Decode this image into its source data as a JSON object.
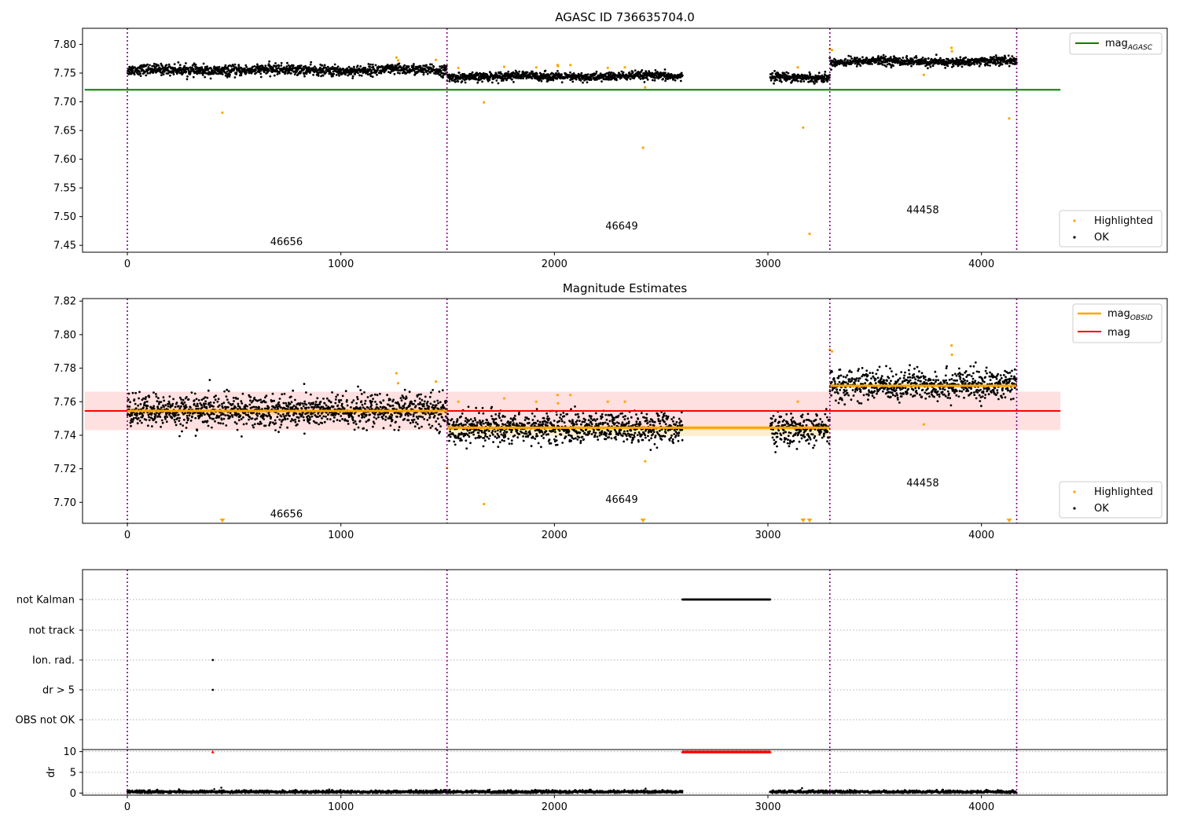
{
  "chart_data": [
    {
      "type": "scatter",
      "title": "AGASC ID 736635704.0",
      "xlabel": "",
      "ylabel": "",
      "xlim": [
        -210,
        4870
      ],
      "ylim": [
        7.438,
        7.828
      ],
      "x_ticks": [
        0,
        1000,
        2000,
        3000,
        4000
      ],
      "y_ticks": [
        7.45,
        7.5,
        7.55,
        7.6,
        7.65,
        7.7,
        7.75,
        7.8
      ],
      "y_tick_labels": [
        "7.45",
        "7.50",
        "7.55",
        "7.60",
        "7.65",
        "7.70",
        "7.75",
        "7.80"
      ],
      "obsid_boundaries": [
        0,
        1497,
        3290,
        4165
      ],
      "obsid_labels": [
        {
          "text": "46656",
          "x": 745,
          "y": 7.456
        },
        {
          "text": "46649",
          "x": 2315,
          "y": 7.483
        },
        {
          "text": "44458",
          "x": 3725,
          "y": 7.511
        }
      ],
      "segments": [
        {
          "x": [
            0,
            1497
          ],
          "y": 7.755,
          "spread": 0.006
        },
        {
          "x": [
            1497,
            2600
          ],
          "y": 7.744,
          "spread": 0.005
        },
        {
          "x": [
            3010,
            3290
          ],
          "y": 7.743,
          "spread": 0.005
        },
        {
          "x": [
            3290,
            4165
          ],
          "y": 7.77,
          "spread": 0.005
        }
      ],
      "series": [
        {
          "name": "mag$_{AGASC}$",
          "kind": "hline",
          "value": 7.721,
          "x": [
            -200,
            4370
          ],
          "color": "#008000"
        },
        {
          "name": "Highlighted",
          "kind": "scatter",
          "color": "#ffa500",
          "points": [
            [
              445,
              7.681
            ],
            [
              1260,
              7.777
            ],
            [
              1268,
              7.772
            ],
            [
              1445,
              7.773
            ],
            [
              1550,
              7.759
            ],
            [
              1670,
              7.699
            ],
            [
              1765,
              7.761
            ],
            [
              1915,
              7.76
            ],
            [
              2015,
              7.764
            ],
            [
              2017,
              7.762
            ],
            [
              2075,
              7.764
            ],
            [
              2250,
              7.759
            ],
            [
              2330,
              7.76
            ],
            [
              2415,
              7.62
            ],
            [
              2425,
              7.725
            ],
            [
              3140,
              7.76
            ],
            [
              3165,
              7.655
            ],
            [
              3195,
              7.47
            ],
            [
              3290,
              7.792
            ],
            [
              3300,
              7.79
            ],
            [
              3730,
              7.747
            ],
            [
              3860,
              7.794
            ],
            [
              3862,
              7.788
            ],
            [
              4130,
              7.671
            ]
          ]
        },
        {
          "name": "OK",
          "kind": "scatter",
          "color": "#000000",
          "points": "dense cloud following segments"
        }
      ],
      "legend": [
        {
          "label": "mag",
          "sub": "AGASC",
          "marker": "line",
          "color": "#008000",
          "position": "upper-right"
        },
        {
          "label": "Highlighted",
          "marker": "dot",
          "color": "#ffa500",
          "position": "lower-right"
        },
        {
          "label": "OK",
          "marker": "dot",
          "color": "#000000",
          "position": "lower-right"
        }
      ]
    },
    {
      "type": "scatter",
      "title": "Magnitude Estimates",
      "xlabel": "",
      "ylabel": "",
      "xlim": [
        -210,
        4870
      ],
      "ylim": [
        7.6875,
        7.8215
      ],
      "x_ticks": [
        0,
        1000,
        2000,
        3000,
        4000
      ],
      "y_ticks": [
        7.7,
        7.72,
        7.74,
        7.76,
        7.78,
        7.8,
        7.82
      ],
      "y_tick_labels": [
        "7.70",
        "7.72",
        "7.74",
        "7.76",
        "7.78",
        "7.80",
        "7.82"
      ],
      "obsid_boundaries": [
        0,
        1497,
        3290,
        4165
      ],
      "obsid_labels": [
        {
          "text": "46656",
          "x": 745,
          "y": 7.693
        },
        {
          "text": "46649",
          "x": 2315,
          "y": 7.7015
        },
        {
          "text": "44458",
          "x": 3725,
          "y": 7.7115
        }
      ],
      "mag_band": {
        "center": 7.7545,
        "low": 7.743,
        "high": 7.766,
        "x": [
          -200,
          4370
        ],
        "color": "#ff0000"
      },
      "obsid_mag": [
        {
          "x": [
            0,
            1497
          ],
          "value": 7.7545,
          "low": 7.752,
          "high": 7.757
        },
        {
          "x": [
            1497,
            3290
          ],
          "value": 7.7445,
          "low": 7.7395,
          "high": 7.7455
        },
        {
          "x": [
            3290,
            4165
          ],
          "value": 7.7695,
          "low": 7.768,
          "high": 7.771
        }
      ],
      "segments": [
        {
          "x": [
            0,
            1497
          ],
          "y": 7.7545,
          "spread": 0.0065
        },
        {
          "x": [
            1497,
            2600
          ],
          "y": 7.7445,
          "spread": 0.006
        },
        {
          "x": [
            3010,
            3290
          ],
          "y": 7.743,
          "spread": 0.006
        },
        {
          "x": [
            3290,
            4165
          ],
          "y": 7.77,
          "spread": 0.006
        }
      ],
      "series": [
        {
          "name": "mag$_{OBSID}$",
          "kind": "steps",
          "color": "#ffa500"
        },
        {
          "name": "mag",
          "kind": "hline",
          "value": 7.7545,
          "color": "#ff0000"
        },
        {
          "name": "Highlighted",
          "kind": "scatter",
          "color": "#ffa500",
          "points": [
            [
              1260,
              7.777
            ],
            [
              1268,
              7.771
            ],
            [
              1445,
              7.772
            ],
            [
              1497,
              7.7205
            ],
            [
              1550,
              7.76
            ],
            [
              1670,
              7.699
            ],
            [
              1765,
              7.762
            ],
            [
              1915,
              7.76
            ],
            [
              2015,
              7.764
            ],
            [
              2017,
              7.759
            ],
            [
              2075,
              7.764
            ],
            [
              2250,
              7.76
            ],
            [
              2330,
              7.76
            ],
            [
              2425,
              7.7245
            ],
            [
              3140,
              7.76
            ],
            [
              3290,
              7.791
            ],
            [
              3300,
              7.79
            ],
            [
              3730,
              7.7465
            ],
            [
              3860,
              7.7935
            ],
            [
              3862,
              7.788
            ]
          ]
        },
        {
          "name": "Highlighted (off-axis markers)",
          "kind": "markers",
          "color": "#ffa500",
          "x": [
            445,
            2415,
            3165,
            3195,
            4130
          ]
        },
        {
          "name": "OK",
          "kind": "scatter",
          "color": "#000000",
          "points": "dense cloud following segments"
        }
      ],
      "legend": [
        {
          "label": "mag",
          "sub": "OBSID",
          "marker": "line",
          "color": "#ffa500",
          "position": "upper-right"
        },
        {
          "label": "mag",
          "sub": "",
          "marker": "line",
          "color": "#ff0000",
          "position": "upper-right"
        },
        {
          "label": "Highlighted",
          "marker": "dot",
          "color": "#ffa500",
          "position": "lower-right"
        },
        {
          "label": "OK",
          "marker": "dot",
          "color": "#000000",
          "position": "lower-right"
        }
      ]
    },
    {
      "type": "scatter",
      "title": "",
      "xlabel": "",
      "ylabel": "",
      "xlim": [
        -210,
        4870
      ],
      "x_ticks": [
        0,
        1000,
        2000,
        3000,
        4000
      ],
      "obsid_boundaries": [
        0,
        1497,
        3290,
        4165
      ],
      "flag_categories": [
        "not Kalman",
        "not track",
        "Ion. rad.",
        "dr > 5",
        "OBS not OK"
      ],
      "flags": [
        {
          "category": "not Kalman",
          "x_range": [
            2600,
            3010
          ]
        },
        {
          "category": "Ion. rad.",
          "points": [
            400
          ]
        },
        {
          "category": "dr > 5",
          "points": [
            400
          ]
        }
      ]
    },
    {
      "type": "scatter",
      "title": "",
      "xlabel": "",
      "ylabel": "dr",
      "xlim": [
        -210,
        4870
      ],
      "ylim": [
        -0.5,
        10.5
      ],
      "x_ticks": [
        0,
        1000,
        2000,
        3000,
        4000
      ],
      "y_ticks": [
        0,
        5,
        10
      ],
      "obsid_boundaries": [
        0,
        1497,
        3290,
        4165
      ],
      "clipped_markers": {
        "color": "#ff0000",
        "value": 10,
        "points": [
          400
        ],
        "x_range": [
          2600,
          3010
        ]
      },
      "segments": [
        {
          "x": [
            0,
            2600
          ],
          "y": 0.3
        },
        {
          "x": [
            3010,
            4165
          ],
          "y": 0.3
        }
      ],
      "outliers": [
        [
          440,
          1.3
        ],
        [
          3160,
          1.2
        ]
      ]
    }
  ]
}
